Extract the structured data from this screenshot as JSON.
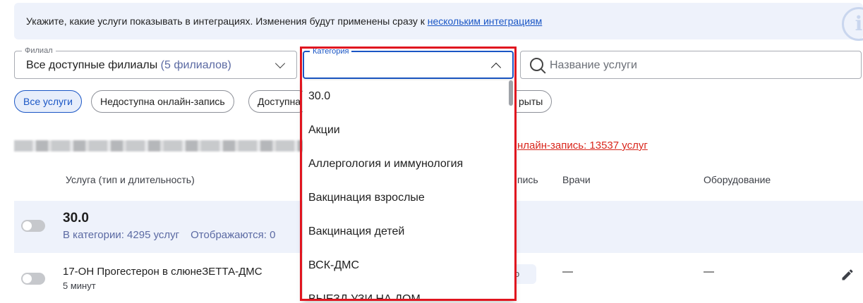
{
  "banner": {
    "text": "Укажите, какие услуги показывать в интеграциях. Изменения будут применены сразу к ",
    "link": "нескольким интеграциям",
    "icon": "info-icon"
  },
  "filters": {
    "branch": {
      "label": "Филиал",
      "value": "Все доступные филиалы",
      "count": "(5 филиалов)"
    },
    "category": {
      "label": "Категория",
      "value": ""
    },
    "search": {
      "placeholder": "Название услуги",
      "value": ""
    }
  },
  "chips": [
    {
      "label": "Все услуги",
      "active": true
    },
    {
      "label": "Недоступна онлайн-запись",
      "active": false
    },
    {
      "label": "Доступна",
      "active": false
    },
    {
      "label": "рыты",
      "active": false
    }
  ],
  "summary": {
    "online_link": "нлайн-запись: 13537 услуг"
  },
  "table": {
    "headers": {
      "service": "Услуга (тип и длительность)",
      "booking": "пись",
      "doctors": "Врачи",
      "equipment": "Оборудование"
    },
    "category_row": {
      "title": "30.0",
      "in_category": "В категории: 4295 услуг",
      "shown": "Отображаются: 0"
    },
    "rows": [
      {
        "title": "17-ОН Прогестерон в слюнеЗЕТТА-ДМС",
        "duration": "5 минут",
        "booking": "о",
        "doctors": "—",
        "equipment": "—"
      }
    ]
  },
  "dropdown": {
    "items": [
      "30.0",
      "Акции",
      "Аллергология и иммунология",
      "Вакцинация взрослые",
      "Вакцинация детей",
      "ВСК-ДМС",
      "ВЫЕЗД УЗИ НА ДОМ"
    ]
  },
  "colors": {
    "accent": "#1a56c5",
    "highlight": "#e0151f",
    "link_red": "#d9261c",
    "banner_bg": "#eef2fb"
  }
}
